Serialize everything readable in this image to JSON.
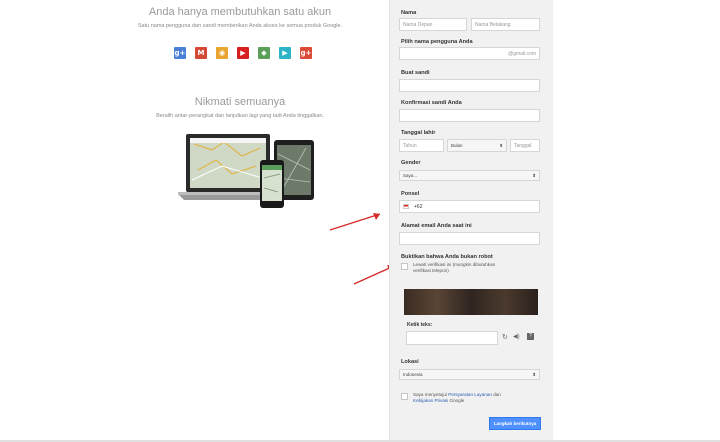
{
  "left": {
    "heading1": "Anda hanya membutuhkan satu akun",
    "sub1": "Satu nama pengguna dan sandi memberikan Anda akses ke semua produk Google.",
    "products": [
      {
        "icon": "google-plus-icon",
        "glyph": "g+",
        "color": "#4a7fd6"
      },
      {
        "icon": "gmail-icon",
        "glyph": "M",
        "color": "#d64937"
      },
      {
        "icon": "chrome-icon",
        "glyph": "◉",
        "color": "#e8a530"
      },
      {
        "icon": "youtube-icon",
        "glyph": "▶",
        "color": "#d81f1f"
      },
      {
        "icon": "maps-icon",
        "glyph": "◆",
        "color": "#5aa05a"
      },
      {
        "icon": "play-icon",
        "glyph": "▶",
        "color": "#2fb3c8"
      },
      {
        "icon": "google-plus-red-icon",
        "glyph": "g+",
        "color": "#dc4a38"
      }
    ],
    "heading2": "Nikmati semuanya",
    "sub2": "Beralih antar-perangkat dan lanjutkan lagi yang tadi Anda tinggalkan."
  },
  "form": {
    "name_label": "Nama",
    "first_name_placeholder": "Nama Depan",
    "last_name_placeholder": "Nama Belakang",
    "username_label": "Pilih nama pengguna Anda",
    "username_suffix": "@gmail.com",
    "password_label": "Buat sandi",
    "confirm_label": "Konfirmasi sandi Anda",
    "birthdate_label": "Tanggal lahir",
    "year_placeholder": "Tahun",
    "month_value": "Bulan",
    "day_placeholder": "Tanggal",
    "gender_label": "Gender",
    "gender_value": "Saya...",
    "phone_label": "Ponsel",
    "phone_value": "+62",
    "email_label": "Alamat email Anda saat ini",
    "robot_label": "Buktikan bahwa Anda bukan robot",
    "skip_text_1": "Lewati verifikasi ini (mungkin dibutuhkan",
    "skip_text_2": "verifikasi telepon)",
    "captcha_label": "Ketik teks:",
    "location_label": "Lokasi",
    "location_value": "Indonesia",
    "agree_prefix": "Saya menyetujui ",
    "terms_link": "Persyaratan Layanan",
    "agree_mid": " dan",
    "privacy_link": "Kebijakan Privasi",
    "agree_suffix": " Google",
    "next_button": "Langkah berikutnya"
  },
  "colors": {
    "accent": "#4d90fe",
    "arrow": "#d42a2a",
    "panel_bg": "#f1f1f1"
  }
}
